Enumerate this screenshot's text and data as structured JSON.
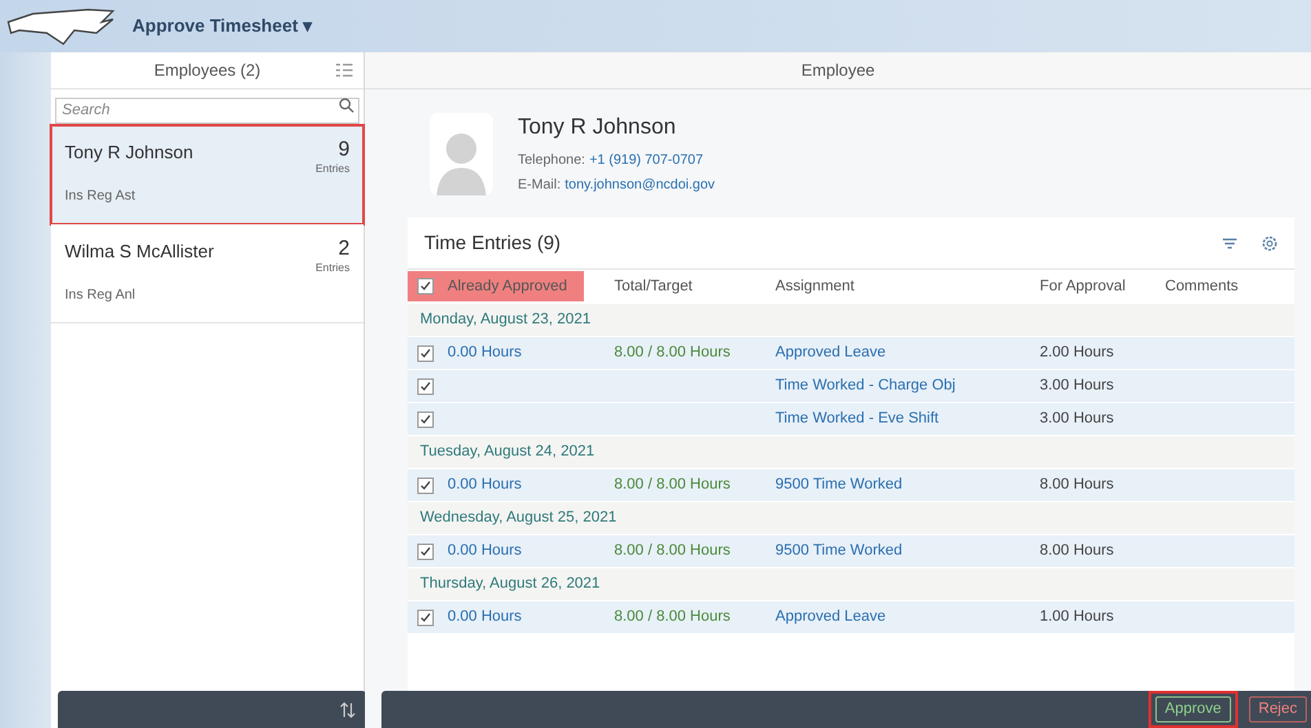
{
  "app_title": "Approve Timesheet ▾",
  "master": {
    "title": "Employees (2)",
    "search": {
      "placeholder": "Search"
    },
    "employees": [
      {
        "name": "Tony R Johnson",
        "count": "9",
        "count_label": "Entries",
        "position": "Ins Reg Ast",
        "selected": true,
        "highlighted": true
      },
      {
        "name": "Wilma S McAllister",
        "count": "2",
        "count_label": "Entries",
        "position": "Ins Reg Anl",
        "selected": false,
        "highlighted": false
      }
    ]
  },
  "detail": {
    "title": "Employee",
    "profile": {
      "name": "Tony R Johnson",
      "telephone_label": "Telephone:",
      "telephone": "+1 (919) 707-0707",
      "email_label": "E-Mail:",
      "email": "tony.johnson@ncdoi.gov"
    },
    "table": {
      "title": "Time Entries (9)",
      "columns": [
        {
          "label": "Already Approved",
          "checked": true,
          "highlighted": true
        },
        {
          "label": "Total/Target"
        },
        {
          "label": "Assignment"
        },
        {
          "label": "For Approval"
        },
        {
          "label": "Comments"
        }
      ],
      "rows": [
        {
          "kind": "group",
          "label": "Monday, August 23, 2021"
        },
        {
          "kind": "entry",
          "checked": true,
          "hours": "0.00 Hours",
          "total": "8.00 / 8.00 Hours",
          "assignment": "Approved Leave",
          "for_approval": "2.00 Hours"
        },
        {
          "kind": "entry",
          "checked": true,
          "assignment": "Time Worked - Charge Obj",
          "for_approval": "3.00 Hours"
        },
        {
          "kind": "entry",
          "checked": true,
          "assignment": "Time Worked - Eve Shift",
          "for_approval": "3.00 Hours"
        },
        {
          "kind": "group",
          "label": "Tuesday, August 24, 2021"
        },
        {
          "kind": "entry",
          "checked": true,
          "hours": "0.00 Hours",
          "total": "8.00 / 8.00 Hours",
          "assignment": "9500 Time Worked",
          "for_approval": "8.00 Hours"
        },
        {
          "kind": "group",
          "label": "Wednesday, August 25, 2021"
        },
        {
          "kind": "entry",
          "checked": true,
          "hours": "0.00 Hours",
          "total": "8.00 / 8.00 Hours",
          "assignment": "9500 Time Worked",
          "for_approval": "8.00 Hours"
        },
        {
          "kind": "group",
          "label": "Thursday, August 26, 2021"
        },
        {
          "kind": "entry",
          "checked": true,
          "hours": "0.00 Hours",
          "total": "8.00 / 8.00 Hours",
          "assignment": "Approved Leave",
          "for_approval": "1.00 Hours"
        }
      ]
    },
    "footer": {
      "buttons": [
        {
          "kind": "approve",
          "label": "Approve",
          "highlighted": true
        },
        {
          "kind": "reject",
          "label": "Rejec",
          "highlighted": false
        }
      ]
    }
  }
}
